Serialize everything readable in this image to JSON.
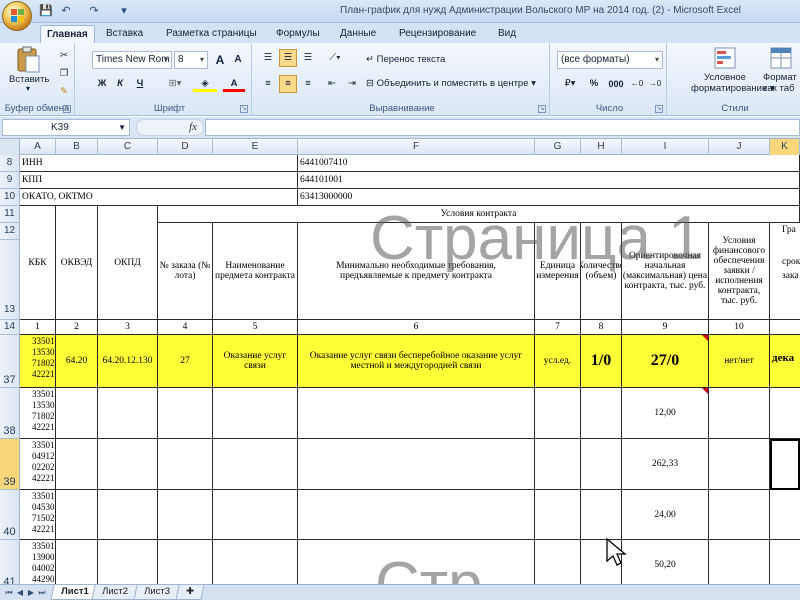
{
  "window": {
    "title": "План-график для нужд Администрации Вольского МР на 2014 год. (2)  -  Microsoft Excel"
  },
  "quick_access": {
    "save_icon": "💾",
    "undo_icon": "↶",
    "redo_icon": "↷",
    "customize_icon": "▾"
  },
  "ribbon_tabs": [
    "Главная",
    "Вставка",
    "Разметка страницы",
    "Формулы",
    "Данные",
    "Рецензирование",
    "Вид"
  ],
  "ribbon": {
    "clipboard": {
      "paste_label": "Вставить",
      "group_label": "Буфер обмена"
    },
    "font": {
      "font_name": "Times New Rom",
      "font_size": "8",
      "bold": "Ж",
      "italic": "К",
      "underline": "Ч",
      "grow": "A",
      "shrink": "A",
      "group_label": "Шрифт"
    },
    "alignment": {
      "wrap_text": "Перенос текста",
      "merge_center": "Объединить и поместить в центре",
      "group_label": "Выравнивание"
    },
    "number": {
      "format": "(все форматы)",
      "percent": "%",
      "thousands": "000",
      "group_label": "Число"
    },
    "styles": {
      "conditional": "Условное",
      "conditional2": "форматирование",
      "format_table": "Формат",
      "format_table2": "как таб",
      "group_label": "Стили"
    },
    "colors": {
      "highlight": "#ffff00",
      "font_color": "#ff0000"
    }
  },
  "formula_bar": {
    "name_box": "K39",
    "fx_label": "fx",
    "value": ""
  },
  "columns": [
    "A",
    "B",
    "C",
    "D",
    "E",
    "F",
    "G",
    "H",
    "I",
    "J",
    "K"
  ],
  "selected_column": "K",
  "rows": {
    "row8": {
      "num": "8",
      "label": "ИНН",
      "value": "6441007410"
    },
    "row9": {
      "num": "9",
      "label": "КПП",
      "value": "644101001"
    },
    "row10": {
      "num": "10",
      "label": "ОКАТО, ОКТМО",
      "value": "63413000000"
    },
    "row11_num": "11",
    "row12_num": "12",
    "row13_num": "13",
    "row14_num": "14",
    "row37_num": "37",
    "row38_num": "38",
    "row39_num": "39",
    "row40_num": "40",
    "row41_num": "41"
  },
  "table_header": {
    "kbk": "КБК",
    "okved": "ОКВЭД",
    "okpd": "ОКПД",
    "contract_conditions": "Условия контракта",
    "order_no": "№ заказа (№ лота)",
    "subject_name": "Наименование предмета контракта",
    "requirements": "Минимально необходимые требования, предъявляемые к предмету контракта",
    "unit": "Единица измерения",
    "quantity": "Количество (объем)",
    "price": "Ориентировочная начальная (максимальная) цена контракта, тыс. руб.",
    "financing": "Условия финансового обеспечения заявки / исполнения контракта, тыс. руб.",
    "schedule_top": "Гра",
    "schedule_sub": "срок",
    "schedule_sub2": "зака"
  },
  "col_numbers": [
    "1",
    "2",
    "3",
    "4",
    "5",
    "6",
    "7",
    "8",
    "9",
    "10"
  ],
  "data_rows": [
    {
      "kbk": "33501 13530 71802 42221",
      "okved": "64.20",
      "okpd": "64.20.12.130",
      "order": "27",
      "name": "Оказание услуг связи",
      "req": "Оказание услуг связи бесперебойное оказание услуг местной и междугородней связи",
      "unit": "усл.ед.",
      "qty": "1/0",
      "price": "27/0",
      "fin": "нет/нет",
      "sched": "дека"
    },
    {
      "kbk": "33501 13530 71802 42221",
      "price": "12,00"
    },
    {
      "kbk": "33501 04912 02202 42221",
      "price": "262,33"
    },
    {
      "kbk": "33501 04530 71502 42221",
      "price": "24,00"
    },
    {
      "kbk": "33501 13900 04002 44290",
      "price": "50,20"
    }
  ],
  "watermarks": {
    "page": "Страница 1",
    "page_bottom": "Стр"
  },
  "status": {
    "sheet_tabs": [
      "Лист1",
      "Лист2",
      "Лист3"
    ],
    "active_sheet": "Лист1"
  },
  "colors": {
    "highlight_row": "#ffff38",
    "selected_header": "#f8d67a",
    "ribbon_bg": "#dbe7f6"
  }
}
